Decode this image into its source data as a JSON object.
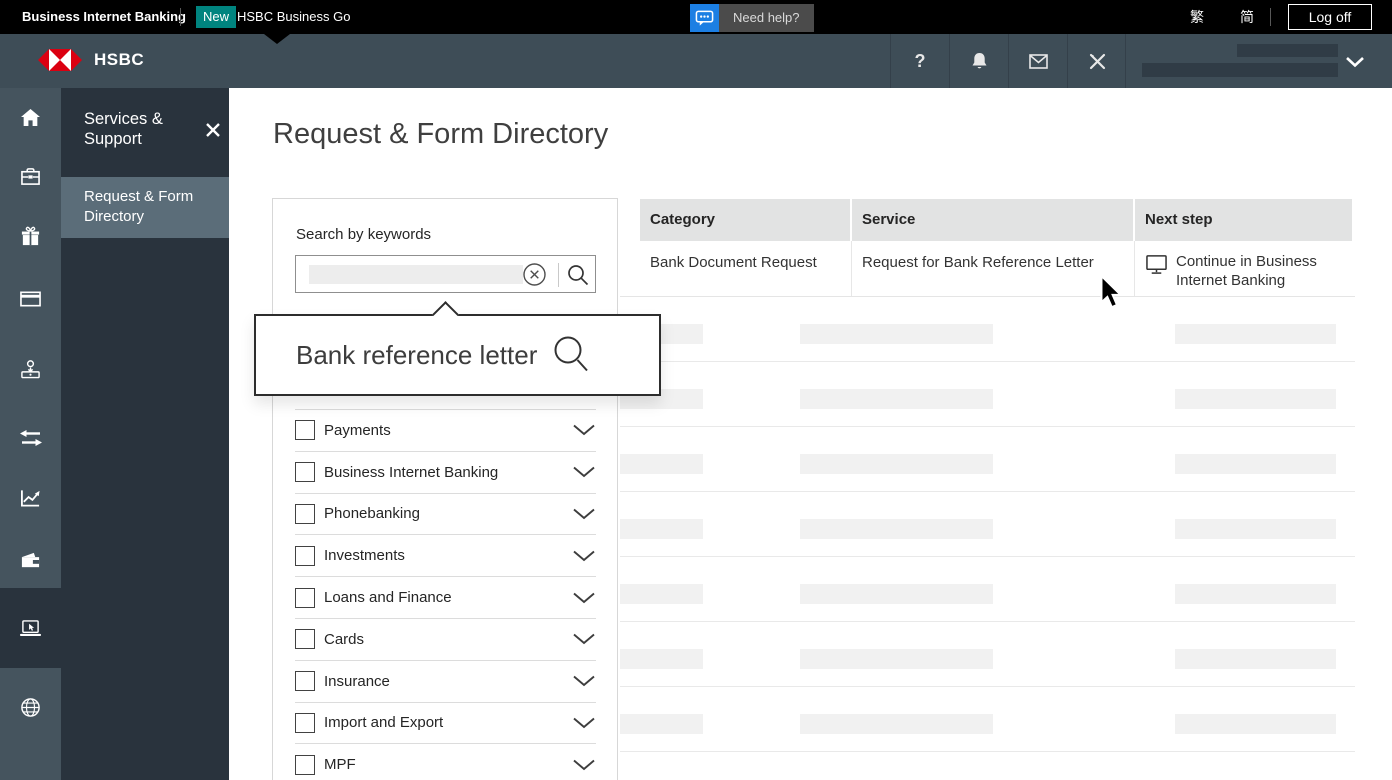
{
  "topbar": {
    "brand": "Business Internet Banking",
    "new_badge": "New",
    "promo": "HSBC Business Go",
    "need_help": "Need help?",
    "lang_traditional": "繁",
    "lang_simplified": "简",
    "logoff": "Log off"
  },
  "appbar": {
    "logo_text": "HSBC",
    "help_glyph": "?",
    "icons": [
      "help-icon",
      "bell-icon",
      "envelope-icon",
      "tools-icon",
      "chevron-down-icon"
    ]
  },
  "nav_rail": {
    "icons": [
      "home-icon",
      "briefcase-icon",
      "gift-icon",
      "credit-card-icon",
      "deposit-icon",
      "transfers-icon",
      "chart-icon",
      "wallet-icon",
      "laptop-cursor-icon",
      "globe-icon"
    ],
    "active_icon": "laptop-cursor-icon"
  },
  "sidebar": {
    "title": "Services & Support",
    "active_item": "Request & Form Directory"
  },
  "page": {
    "title": "Request & Form Directory"
  },
  "search_panel": {
    "label": "Search by keywords",
    "categories": [
      "Payments",
      "Business Internet Banking",
      "Phonebanking",
      "Investments",
      "Loans and Finance",
      "Cards",
      "Insurance",
      "Import and Export",
      "MPF"
    ]
  },
  "search_tooltip": {
    "text": "Bank reference letter"
  },
  "results_table": {
    "columns": [
      "Category",
      "Service",
      "Next step"
    ],
    "rows": [
      {
        "category": "Bank Document Request",
        "service": "Request for Bank Reference Letter",
        "next_step": "Continue in Business Internet Banking",
        "next_step_icon": "monitor-icon"
      }
    ],
    "skeleton_row_count": 7
  },
  "colors": {
    "hsbc_red": "#db0011",
    "teal_badge": "#00847f",
    "topbar_bg": "#000000",
    "appbar_bg": "#3e4d57",
    "rail_bg": "#45545e",
    "panel_bg": "#29333d",
    "selected_item_bg": "#5b6d79",
    "need_help_blue": "#1c7fe3",
    "header_cell_bg": "#e2e3e3",
    "skeleton_light": "#f1f1f1",
    "skeleton_dark": "#303c46"
  }
}
